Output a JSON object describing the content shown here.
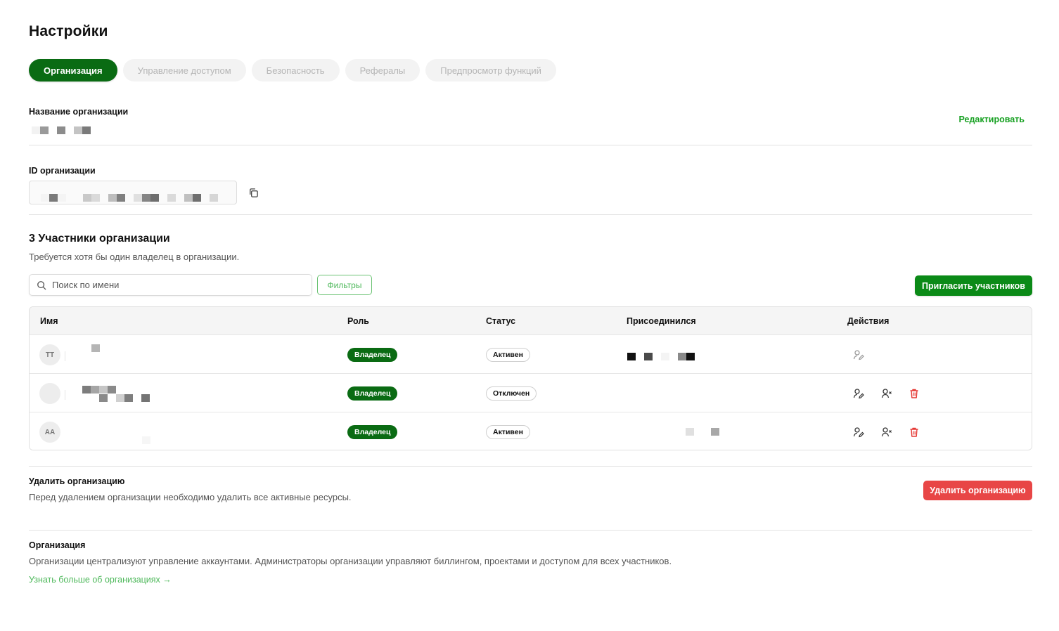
{
  "page": {
    "title": "Настройки"
  },
  "tabs": [
    {
      "label": "Организация",
      "active": true
    },
    {
      "label": "Управление доступом",
      "active": false
    },
    {
      "label": "Безопасность",
      "active": false
    },
    {
      "label": "Рефералы",
      "active": false
    },
    {
      "label": "Предпросмотр функций",
      "active": false
    }
  ],
  "org_name": {
    "label": "Название организации",
    "edit_label": "Редактировать"
  },
  "org_id": {
    "label": "ID организации",
    "copy_icon": "copy-icon"
  },
  "members": {
    "title": "3 Участники организации",
    "subtitle": "Требуется хотя бы один владелец в организации.",
    "search_placeholder": "Поиск по имени",
    "filters_label": "Фильтры",
    "invite_label": "Пригласить участников",
    "columns": [
      "Имя",
      "Роль",
      "Статус",
      "Присоединился",
      "Действия"
    ],
    "rows": [
      {
        "initials": "TT",
        "role": "Владелец",
        "status": "Активен",
        "actions": [
          "edit-role-icon"
        ]
      },
      {
        "initials": "",
        "role": "Владелец",
        "status": "Отключен",
        "actions": [
          "edit-role-icon",
          "remove-user-icon",
          "trash-icon"
        ]
      },
      {
        "initials": "AA",
        "role": "Владелец",
        "status": "Активен",
        "actions": [
          "edit-role-icon",
          "remove-user-icon",
          "trash-icon"
        ]
      }
    ]
  },
  "delete_org": {
    "title": "Удалить организацию",
    "description": "Перед удалением организации необходимо удалить все активные ресурсы.",
    "button_label": "Удалить организацию"
  },
  "about": {
    "title": "Организация",
    "description": "Организации централизуют управление аккаунтами. Администраторы организации управляют биллингом, проектами и доступом для всех участников.",
    "link_label": "Узнать больше об организациях →"
  },
  "colors": {
    "brand": "#0a6b13",
    "accent": "#16a021",
    "danger": "#e84646"
  }
}
